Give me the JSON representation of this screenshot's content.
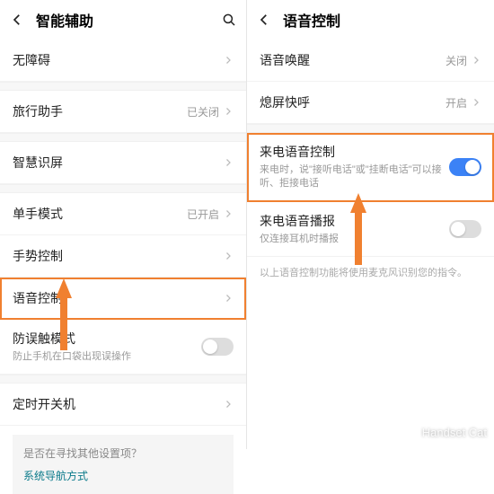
{
  "left": {
    "title": "智能辅助",
    "items": {
      "accessibility": {
        "label": "无障碍"
      },
      "travel": {
        "label": "旅行助手",
        "status": "已关闭"
      },
      "smart": {
        "label": "智慧识屏"
      },
      "onehand": {
        "label": "单手模式",
        "status": "已开启"
      },
      "gesture": {
        "label": "手势控制"
      },
      "voice": {
        "label": "语音控制"
      },
      "mistouch": {
        "label": "防误触模式",
        "sub": "防止手机在口袋出现误操作"
      },
      "scheduled": {
        "label": "定时开关机"
      }
    },
    "hint": {
      "q": "是否在寻找其他设置项？",
      "link": "系统导航方式"
    }
  },
  "right": {
    "title": "语音控制",
    "items": {
      "wake": {
        "label": "语音唤醒",
        "status": "关闭"
      },
      "quick": {
        "label": "熄屏快呼",
        "status": "开启"
      },
      "incoming": {
        "label": "来电语音控制",
        "sub": "来电时，说\"接听电话\"或\"挂断电话\"可以接听、拒接电话"
      },
      "announce": {
        "label": "来电语音播报",
        "sub": "仅连接耳机时播报"
      }
    },
    "footnote": "以上语音控制功能将使用麦克风识别您的指令。"
  },
  "watermark": "Handset Cat"
}
